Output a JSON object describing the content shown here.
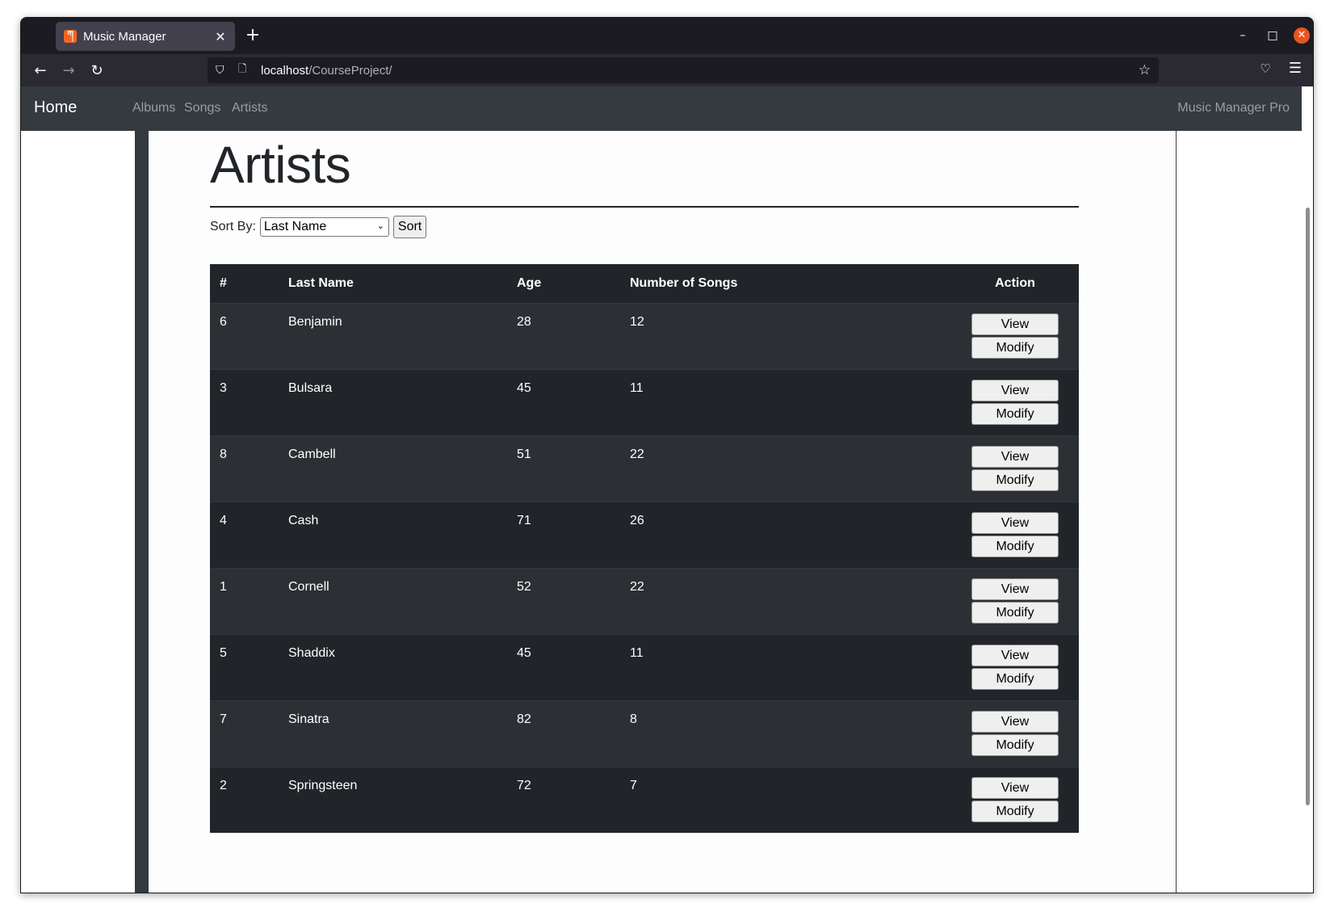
{
  "browser": {
    "tab_title": "Music Manager",
    "tab_favicon": "xampp-icon",
    "url_host": "localhost",
    "url_path": "/CourseProject/"
  },
  "site_nav": {
    "brand": "Home",
    "links": [
      "Albums",
      "Songs",
      "Artists"
    ],
    "right_text": "Music Manager Pro"
  },
  "page": {
    "title": "Artists",
    "sort_label": "Sort By:",
    "sort_selected": "Last Name",
    "sort_button": "Sort"
  },
  "table": {
    "headers": [
      "#",
      "Last Name",
      "Age",
      "Number of Songs",
      "Action"
    ],
    "rows": [
      {
        "id": "6",
        "last_name": "Benjamin",
        "age": "28",
        "songs": "12"
      },
      {
        "id": "3",
        "last_name": "Bulsara",
        "age": "45",
        "songs": "11"
      },
      {
        "id": "8",
        "last_name": "Cambell",
        "age": "51",
        "songs": "22"
      },
      {
        "id": "4",
        "last_name": "Cash",
        "age": "71",
        "songs": "26"
      },
      {
        "id": "1",
        "last_name": "Cornell",
        "age": "52",
        "songs": "22"
      },
      {
        "id": "5",
        "last_name": "Shaddix",
        "age": "45",
        "songs": "11"
      },
      {
        "id": "7",
        "last_name": "Sinatra",
        "age": "82",
        "songs": "8"
      },
      {
        "id": "2",
        "last_name": "Springsteen",
        "age": "72",
        "songs": "7"
      }
    ],
    "view_label": "View",
    "modify_label": "Modify"
  },
  "colors": {
    "nav_bg": "#343a40",
    "table_header": "#212529",
    "row_odd": "#2c3034",
    "row_even": "#212529",
    "close_button": "#e95420"
  }
}
